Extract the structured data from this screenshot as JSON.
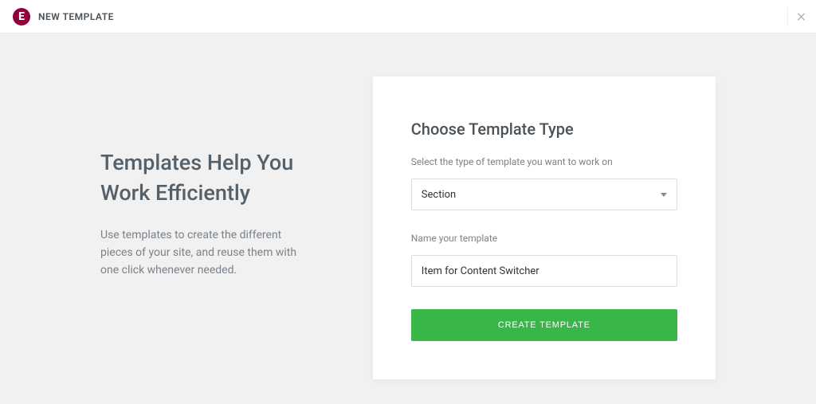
{
  "header": {
    "title": "NEW TEMPLATE"
  },
  "left": {
    "heading_line1": "Templates Help You",
    "heading_line2": "Work Efficiently",
    "description": "Use templates to create the different pieces of your site, and reuse them with one click whenever needed."
  },
  "form": {
    "title": "Choose Template Type",
    "type_help": "Select the type of template you want to work on",
    "type_value": "Section",
    "name_label": "Name your template",
    "name_value": "Item for Content Switcher",
    "submit_label": "CREATE TEMPLATE"
  }
}
